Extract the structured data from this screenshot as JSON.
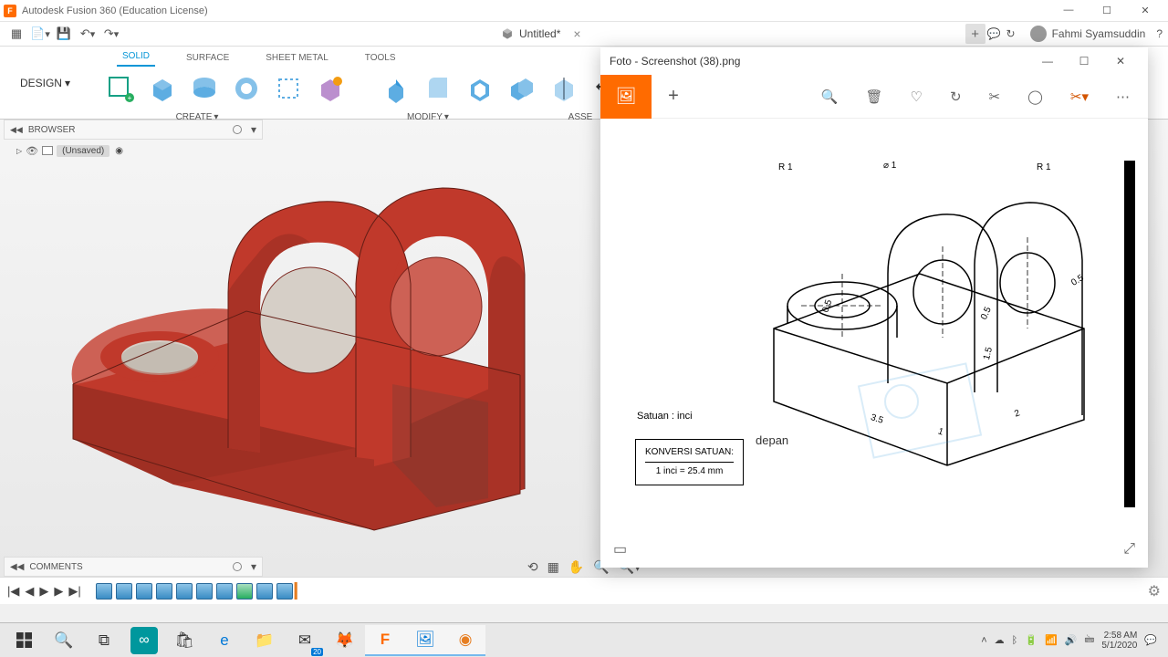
{
  "window": {
    "title": "Autodesk Fusion 360 (Education License)"
  },
  "doc": {
    "name": "Untitled*"
  },
  "user": {
    "name": "Fahmi Syamsuddin"
  },
  "workspace": "DESIGN",
  "tabs": {
    "solid": "SOLID",
    "surface": "SURFACE",
    "sheet": "SHEET METAL",
    "tools": "TOOLS"
  },
  "groups": {
    "create": "CREATE",
    "modify": "MODIFY",
    "assemble": "ASSE"
  },
  "browser": {
    "label": "BROWSER",
    "root": "(Unsaved)"
  },
  "comments": {
    "label": "COMMENTS"
  },
  "photos": {
    "title": "Foto - Screenshot (38).png",
    "unit_label": "Satuan : inci",
    "conv_hd": "KONVERSI SATUAN:",
    "conv_val": "1 inci = 25.4 mm",
    "depan": "depan",
    "dims": {
      "r1a": "R 1",
      "d1": "⌀ 1",
      "r1b": "R 1",
      "p05a": "0.5",
      "p05b": "0.5",
      "p05c": "0.5",
      "p15": "1.5",
      "p2": "2",
      "p1": "1",
      "p35": "3.5"
    }
  },
  "clock": {
    "time": "2:58 AM",
    "date": "5/1/2020"
  },
  "tray": {
    "badge": "20"
  }
}
